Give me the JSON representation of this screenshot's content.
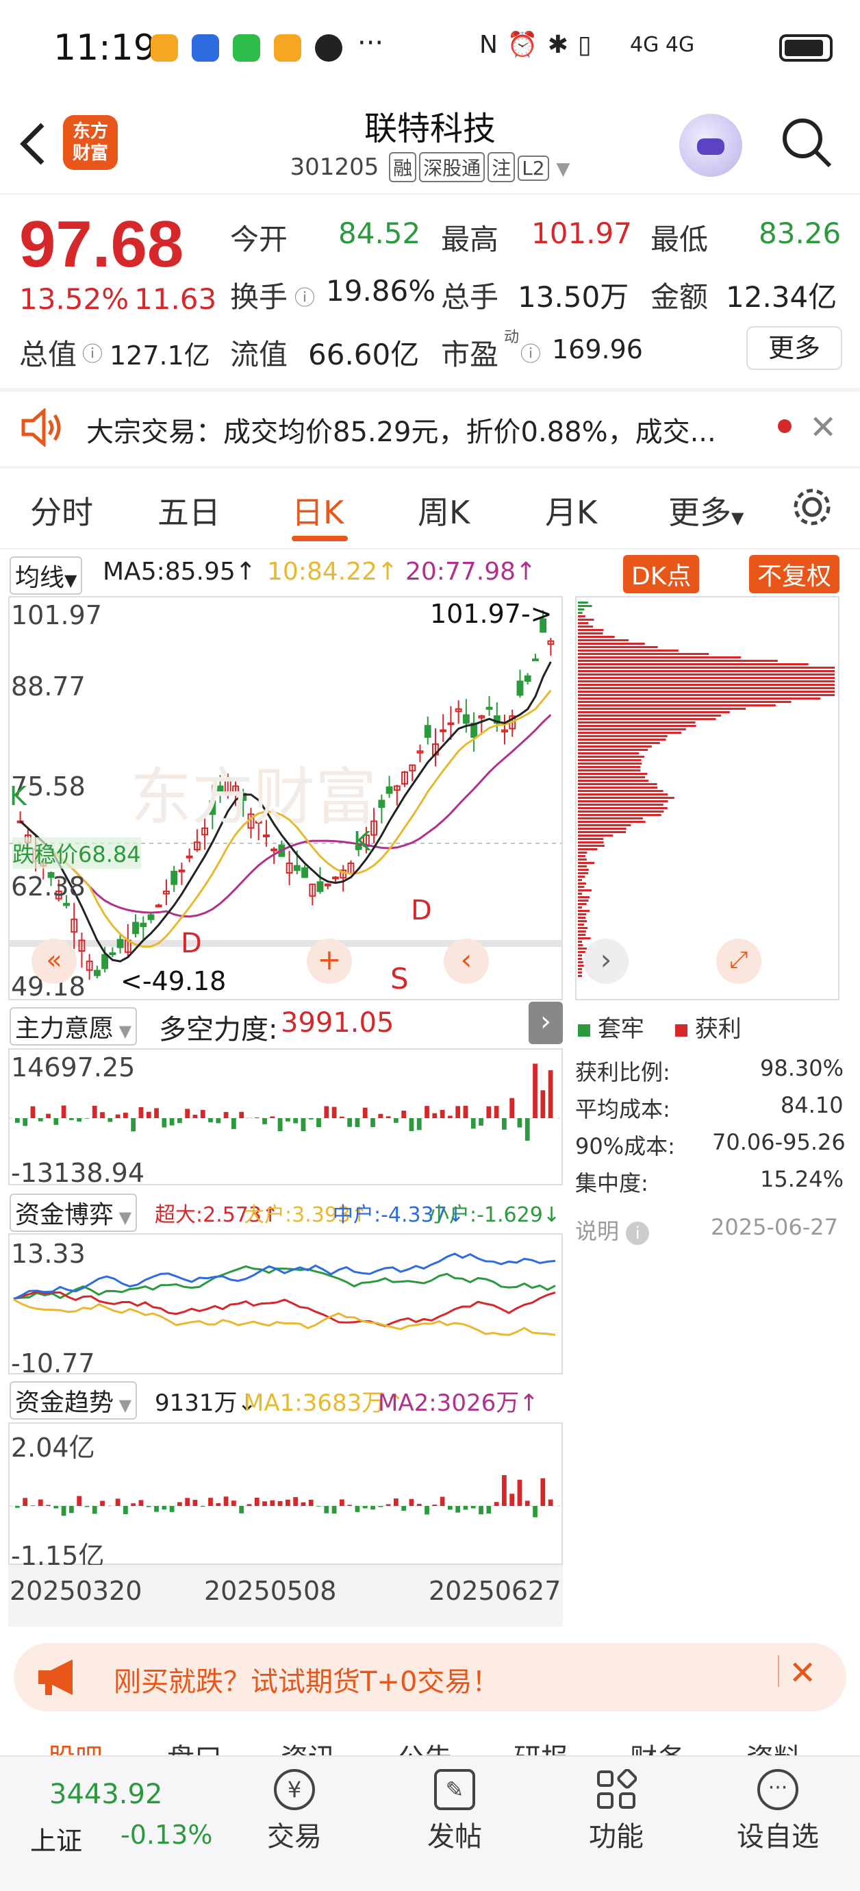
{
  "status_bar": {
    "time": "11:19",
    "signal_text": "4G 4G",
    "more": "···"
  },
  "header": {
    "back_icon": "chevron-left-icon",
    "logo_line1": "东方",
    "logo_line2": "财富",
    "stock_name": "联特科技",
    "stock_code": "301205",
    "tags": [
      "融",
      "深股通",
      "注",
      "L2"
    ]
  },
  "quote": {
    "price": "97.68",
    "change_pct": "13.52%",
    "change_amt": "11.63",
    "open_label": "今开",
    "open": "84.52",
    "high_label": "最高",
    "high": "101.97",
    "low_label": "最低",
    "low": "83.26",
    "turnover_label": "换手",
    "turnover": "19.86%",
    "volume_label": "总手",
    "volume": "13.50万",
    "amount_label": "金额",
    "amount": "12.34亿",
    "mktcap_label": "总值",
    "mktcap": "127.1亿",
    "float_label": "流值",
    "float": "66.60亿",
    "pe_label": "市盈",
    "pe_sup": "动",
    "pe": "169.96",
    "more_label": "更多"
  },
  "notice": {
    "text": "大宗交易：成交均价85.29元，折价0.88%，成交..."
  },
  "tabs": [
    "分时",
    "五日",
    "日K",
    "周K",
    "月K",
    "更多"
  ],
  "active_tab": "日K",
  "kline": {
    "ma_label": "均线",
    "ma5": "MA5:85.95↑",
    "ma10": "10:84.22↑",
    "ma20": "20:77.98↑",
    "dk_label": "DK点",
    "fq_label": "不复权",
    "y_labels": [
      "101.97",
      "88.77",
      "75.58",
      "62.38",
      "49.18"
    ],
    "max_marker": "101.97->",
    "min_marker": "<-49.18",
    "cost_line_label": "跌稳价68.84",
    "signal_d": "D",
    "signal_s": "S",
    "signal_k": "K",
    "watermark": "东方财富"
  },
  "chip": {
    "legend_trapped": "套牢",
    "legend_profit": "获利",
    "rows": [
      {
        "label": "获利比例:",
        "value": "98.30%"
      },
      {
        "label": "平均成本:",
        "value": "84.10"
      },
      {
        "label": "90%成本:",
        "value": "70.06-95.26"
      },
      {
        "label": "集中度:",
        "value": "15.24%"
      }
    ],
    "explain": "说明",
    "date": "2025-06-27"
  },
  "main_force": {
    "selector": "主力意愿",
    "power_label": "多空力度:",
    "power_value": "3991.05",
    "y_top": "14697.25",
    "y_bottom": "-13138.94"
  },
  "capital_game": {
    "selector": "资金博弈",
    "super": "超大:2.573↑",
    "large": "大户:3.393↑",
    "mid": "中户:-4.337↓",
    "small": "小户:-1.629↓",
    "y_top": "13.33",
    "y_bottom": "-10.77"
  },
  "capital_trend": {
    "selector": "资金趋势",
    "value": "9131万↓",
    "ma1": "MA1:3683万↑",
    "ma2": "MA2:3026万↑",
    "y_top": "2.04亿",
    "y_bottom": "-1.15亿",
    "dates": [
      "20250320",
      "20250508",
      "20250627"
    ]
  },
  "promo": {
    "text": "刚买就跌？试试期货T+0交易！"
  },
  "bottom_tabs_partial": [
    "股吧",
    "盘口",
    "资讯",
    "公告",
    "研报",
    "财务",
    "资料"
  ],
  "bottom_nav": {
    "index_value": "3443.92",
    "index_name": "上证",
    "index_change": "-0.13%",
    "items": [
      "交易",
      "发帖",
      "功能",
      "设自选"
    ]
  },
  "colors": {
    "up": "#d6272a",
    "down": "#2a9a3c",
    "accent": "#e8561a",
    "ma5": "#222222",
    "ma10": "#e8b830",
    "ma20": "#b0308a"
  }
}
